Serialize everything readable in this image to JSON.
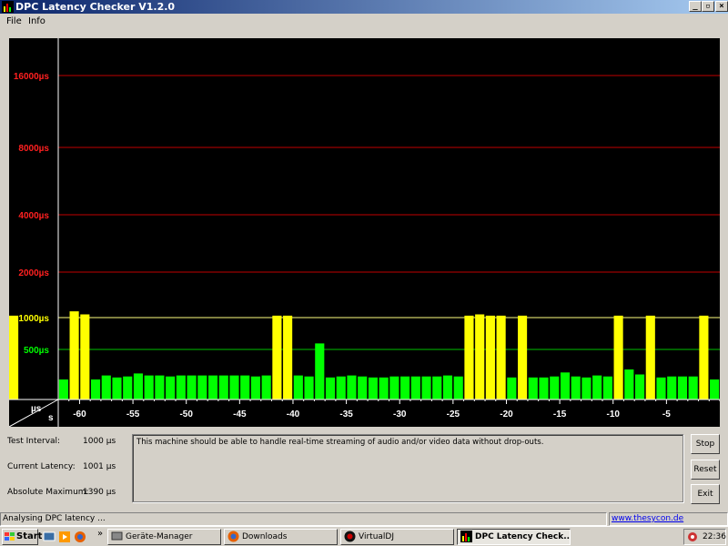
{
  "window": {
    "title": "DPC Latency Checker V1.2.0"
  },
  "menu": {
    "items": [
      "File",
      "Info"
    ]
  },
  "chart_data": {
    "type": "bar",
    "ylabel": "µs",
    "xlabel": "s",
    "y_tick_labels": [
      "16000µs",
      "8000µs",
      "4000µs",
      "2000µs",
      "1000µs",
      "500µs"
    ],
    "y_ticks": [
      16000,
      8000,
      4000,
      2000,
      1000,
      500
    ],
    "x_tick_labels": [
      "-60",
      "-55",
      "-50",
      "-45",
      "-40",
      "-35",
      "-30",
      "-25",
      "-20",
      "-15",
      "-10",
      "-5"
    ],
    "x_ticks": [
      -60,
      -55,
      -50,
      -45,
      -40,
      -35,
      -30,
      -25,
      -20,
      -15,
      -10,
      -5
    ],
    "x_range": [
      -62,
      0
    ],
    "threshold_colors": {
      "ok": "#00ff00",
      "warning": "#ffff00"
    },
    "x": [
      -62,
      -61,
      -60,
      -59,
      -58,
      -57,
      -56,
      -55,
      -54,
      -53,
      -52,
      -51,
      -50,
      -49,
      -48,
      -47,
      -46,
      -45,
      -44,
      -43,
      -42,
      -41,
      -40,
      -39,
      -38,
      -37,
      -36,
      -35,
      -34,
      -33,
      -32,
      -31,
      -30,
      -29,
      -28,
      -27,
      -26,
      -25,
      -24,
      -23,
      -22,
      -21,
      -20,
      -19,
      -18,
      -17,
      -16,
      -15,
      -14,
      -13,
      -12,
      -11,
      -10,
      -9,
      -8,
      -7,
      -6,
      -5,
      -4,
      -3,
      -2,
      -1
    ],
    "values": [
      200,
      1100,
      1050,
      200,
      240,
      220,
      230,
      260,
      240,
      240,
      230,
      240,
      240,
      240,
      240,
      240,
      240,
      240,
      230,
      240,
      1030,
      1030,
      240,
      230,
      570,
      220,
      230,
      240,
      230,
      220,
      220,
      230,
      230,
      230,
      230,
      230,
      240,
      230,
      1030,
      1050,
      1030,
      1030,
      220,
      1030,
      220,
      220,
      230,
      270,
      230,
      220,
      240,
      230,
      1030,
      300,
      250,
      1030,
      220,
      230,
      230,
      230,
      1030,
      200,
      1030
    ]
  },
  "info": {
    "test_interval_label": "Test Interval:",
    "test_interval_value": "1000 µs",
    "current_latency_label": "Current Latency:",
    "current_latency_value": "1001 µs",
    "absolute_max_label": "Absolute Maximum:",
    "absolute_max_value": "1390 µs"
  },
  "message": "This machine should be able to handle real-time streaming of audio and/or video data without drop-outs.",
  "buttons": {
    "stop": "Stop",
    "reset": "Reset",
    "exit": "Exit"
  },
  "status": {
    "text": "Analysing DPC latency ...",
    "link": "www.thesycon.de"
  },
  "taskbar": {
    "start": "Start",
    "tasks": [
      "Geräte-Manager",
      "Downloads",
      "VirtualDJ",
      "DPC Latency Check..."
    ],
    "clock": "22:36"
  }
}
